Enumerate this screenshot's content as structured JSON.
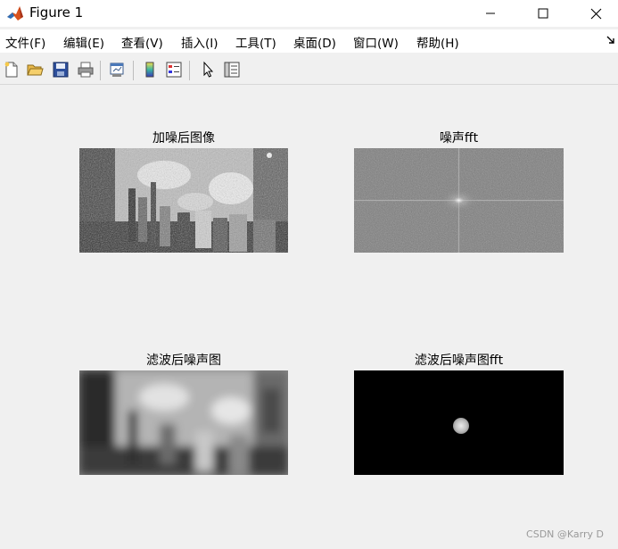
{
  "window": {
    "title": "Figure 1",
    "controls": {
      "minimize": "—",
      "maximize": "☐",
      "close": "✕"
    }
  },
  "menu": {
    "items": [
      "文件(F)",
      "编辑(E)",
      "查看(V)",
      "插入(I)",
      "工具(T)",
      "桌面(D)",
      "窗口(W)",
      "帮助(H)"
    ],
    "overflow_icon": "dock-arrow-icon"
  },
  "toolbar": {
    "icons": [
      "new-figure-icon",
      "open-file-icon",
      "save-icon",
      "print-icon",
      "link-plot-icon",
      "colorbar-icon",
      "legend-icon",
      "pointer-icon",
      "property-inspector-icon"
    ]
  },
  "subplots": [
    {
      "title": "加噪后图像",
      "content": "noisy-city-image"
    },
    {
      "title": "噪声fft",
      "content": "noisy-fft-spectrum"
    },
    {
      "title": "滤波后噪声图",
      "content": "filtered-blurry-image"
    },
    {
      "title": "滤波后噪声图fft",
      "content": "filtered-fft-spectrum"
    }
  ],
  "watermark": "CSDN @Karry D"
}
